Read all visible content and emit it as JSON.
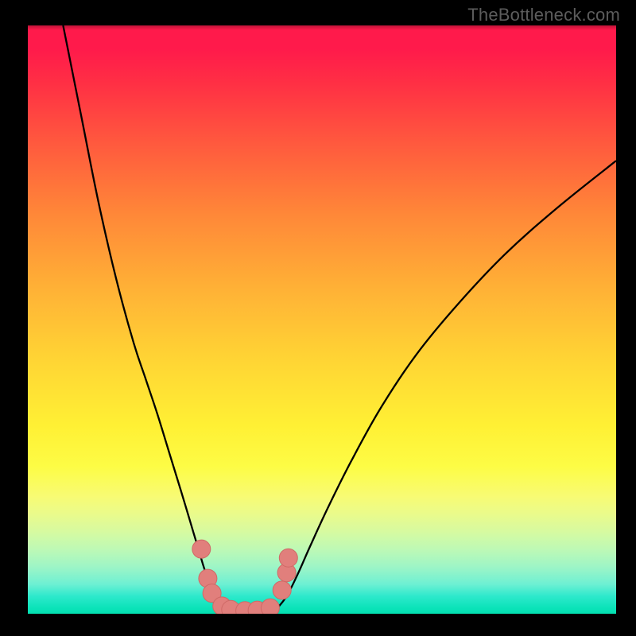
{
  "watermark": {
    "text": "TheBottleneck.com"
  },
  "colors": {
    "frame": "#000000",
    "curve_stroke": "#000000",
    "marker_fill": "#e17f7c",
    "marker_stroke": "#cf6966"
  },
  "chart_data": {
    "type": "line",
    "title": "",
    "xlabel": "",
    "ylabel": "",
    "xlim": [
      0,
      100
    ],
    "ylim": [
      0,
      100
    ],
    "grid": false,
    "note": "Axis values are nominal percentages read from pixel positions; the source chart shows no tick labels.",
    "series": [
      {
        "name": "left-curve",
        "x": [
          6,
          9,
          12,
          15,
          18,
          20,
          22,
          24,
          26,
          27.5,
          29,
          30.6,
          33,
          34.5
        ],
        "y": [
          100,
          85,
          70,
          57,
          46,
          40,
          34,
          27.5,
          21,
          16,
          11,
          6,
          1.3,
          0.5
        ]
      },
      {
        "name": "right-curve",
        "x": [
          42,
          44,
          46,
          48,
          51,
          55,
          60,
          66,
          73,
          81,
          90,
          100
        ],
        "y": [
          0.5,
          3,
          7,
          11.5,
          18,
          26,
          35,
          44,
          52.5,
          61,
          69,
          77
        ]
      },
      {
        "name": "trough-markers",
        "type": "scatter",
        "x": [
          29.5,
          30.6,
          31.3,
          33.0,
          34.5,
          36.9,
          39.0,
          41.2,
          43.2,
          44.0,
          44.3
        ],
        "y": [
          11.0,
          6.0,
          3.5,
          1.3,
          0.7,
          0.5,
          0.6,
          1.0,
          4.0,
          7.0,
          9.5
        ]
      }
    ]
  }
}
